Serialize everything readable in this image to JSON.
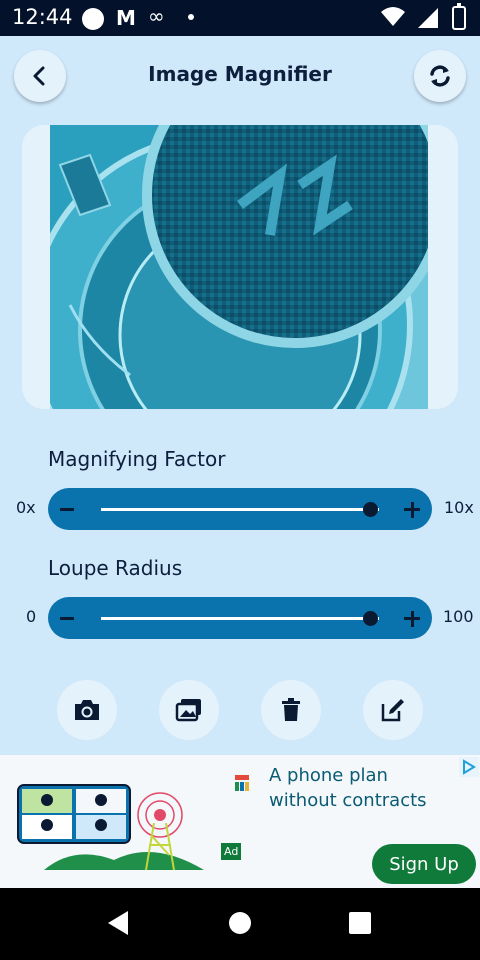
{
  "status_bar": {
    "time": "12:44"
  },
  "header": {
    "title": "Image Magnifier"
  },
  "magnifying_factor": {
    "label": "Magnifying Factor",
    "min_label": "0x",
    "max_label": "10x",
    "value_fraction": 0.97
  },
  "loupe_radius": {
    "label": "Loupe Radius",
    "min_label": "0",
    "max_label": "100",
    "value_fraction": 0.97
  },
  "actions": [
    "camera-icon",
    "gallery-icon",
    "trash-icon",
    "edit-icon"
  ],
  "ad": {
    "headline": "A phone plan without contracts",
    "badge": "Ad",
    "cta": "Sign Up"
  },
  "colors": {
    "background": "#cfe8fa",
    "slider": "#0a73ad",
    "card": "#e4f2fc",
    "cta": "#0f7a3a"
  }
}
